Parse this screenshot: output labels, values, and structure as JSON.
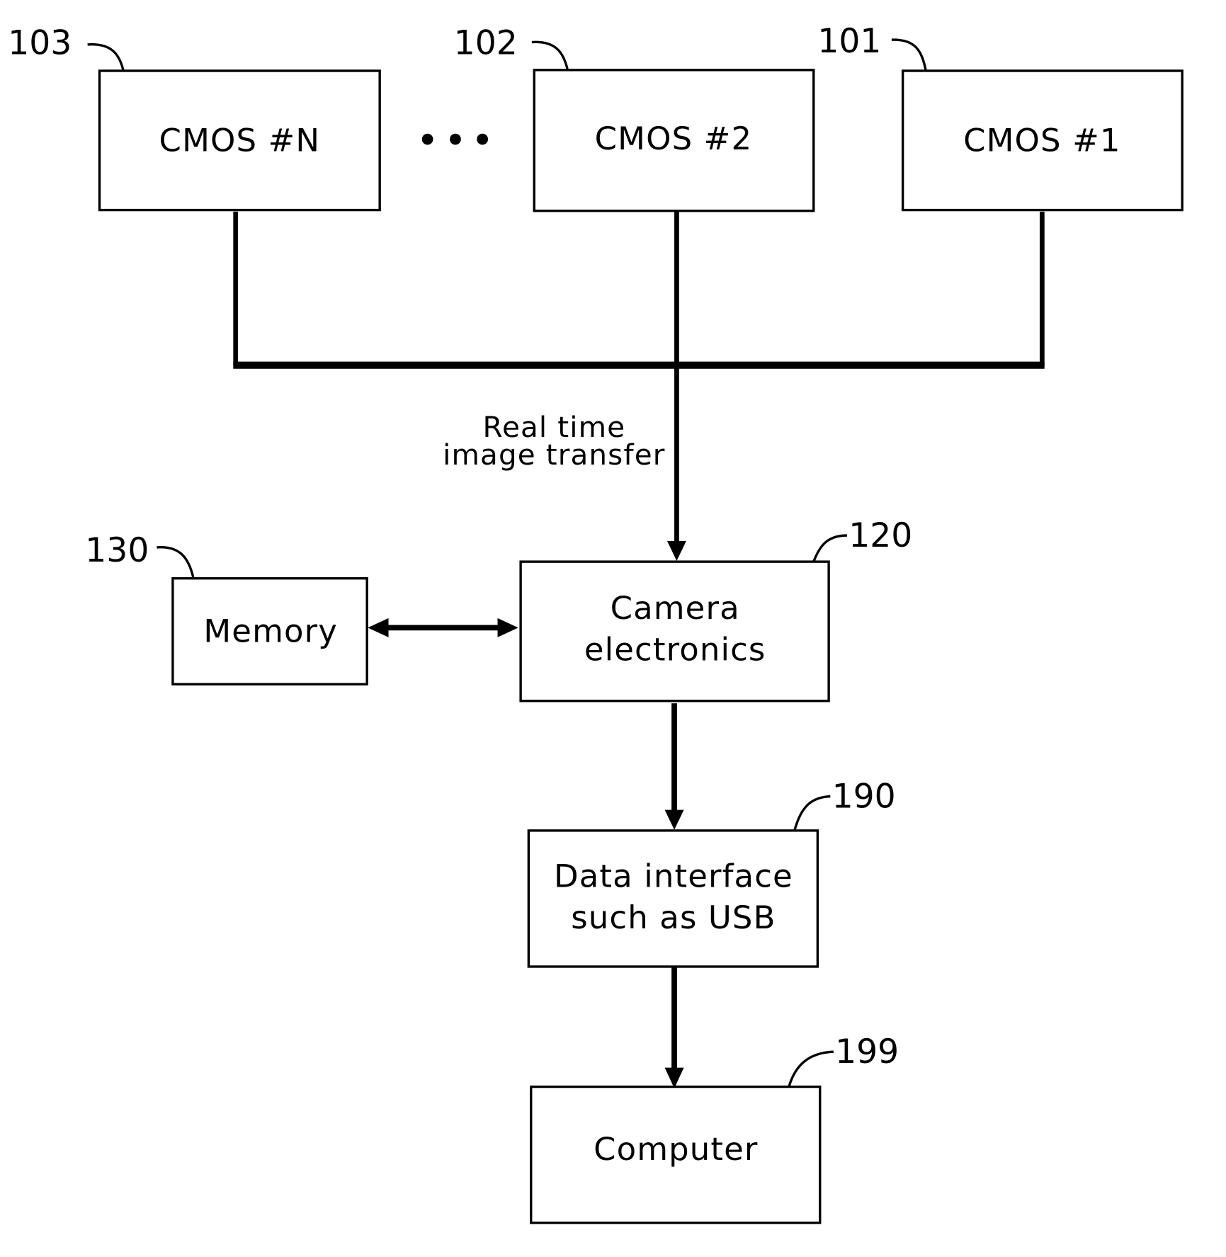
{
  "diagram": {
    "type": "block-diagram",
    "nodes": {
      "cmos_n": {
        "label": "CMOS #N",
        "ref": "103"
      },
      "cmos_2": {
        "label": "CMOS #2",
        "ref": "102"
      },
      "cmos_1": {
        "label": "CMOS #1",
        "ref": "101"
      },
      "memory": {
        "label": "Memory",
        "ref": "130"
      },
      "camera": {
        "label_line1": "Camera",
        "label_line2": "electronics",
        "ref": "120"
      },
      "data_interface": {
        "label_line1": "Data interface",
        "label_line2": "such as USB",
        "ref": "190"
      },
      "computer": {
        "label": "Computer",
        "ref": "199"
      }
    },
    "annotations": {
      "transfer_line1": "Real time",
      "transfer_line2": "image transfer"
    },
    "ellipsis": "•••",
    "edges": [
      {
        "from": "cmos_n",
        "to": "camera",
        "type": "bus"
      },
      {
        "from": "cmos_2",
        "to": "camera",
        "type": "bus"
      },
      {
        "from": "cmos_1",
        "to": "camera",
        "type": "bus"
      },
      {
        "from": "memory",
        "to": "camera",
        "type": "bidirectional"
      },
      {
        "from": "camera",
        "to": "data_interface",
        "type": "directed"
      },
      {
        "from": "data_interface",
        "to": "computer",
        "type": "directed"
      }
    ]
  }
}
